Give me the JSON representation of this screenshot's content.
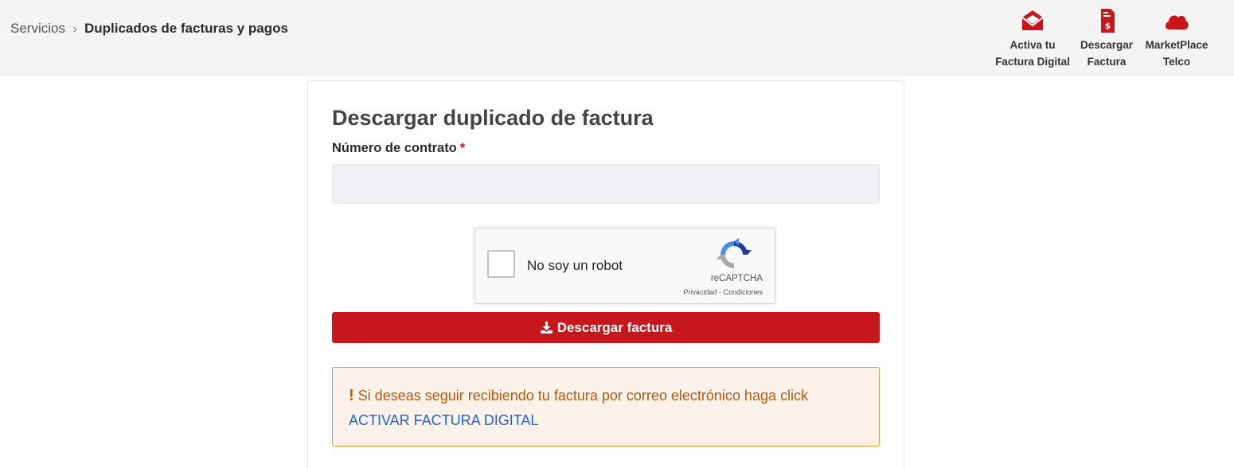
{
  "breadcrumb": {
    "parent": "Servicios",
    "separator": "›",
    "current": "Duplicados de facturas y pagos"
  },
  "quick_links": [
    {
      "label_line1": "Activa tu",
      "label_line2": "Factura Digital",
      "icon": "open-envelope-icon"
    },
    {
      "label_line1": "Descargar",
      "label_line2": "Factura",
      "icon": "invoice-dollar-icon"
    },
    {
      "label_line1": "MarketPlace",
      "label_line2": "Telco",
      "icon": "cloud-icon"
    }
  ],
  "form": {
    "title": "Descargar duplicado de factura",
    "contract_label": "Número de contrato",
    "required_mark": "*",
    "contract_value": "",
    "contract_placeholder": ""
  },
  "recaptcha": {
    "checkbox_label": "No soy un robot",
    "brand": "reCAPTCHA",
    "privacy": "Privacidad",
    "links_sep": " - ",
    "terms": "Condiciones"
  },
  "download_button": {
    "label": "Descargar factura",
    "icon": "download-icon"
  },
  "notice": {
    "bang": "!",
    "text": " Si deseas seguir recibiendo tu factura por correo electrónico haga click ",
    "link": "ACTIVAR FACTURA DIGITAL"
  },
  "colors": {
    "brand_red": "#c8161d",
    "notice_bg": "#fdf2ea",
    "notice_border": "#e8973f",
    "notice_text": "#b35a12",
    "link_blue": "#1f63d3"
  }
}
